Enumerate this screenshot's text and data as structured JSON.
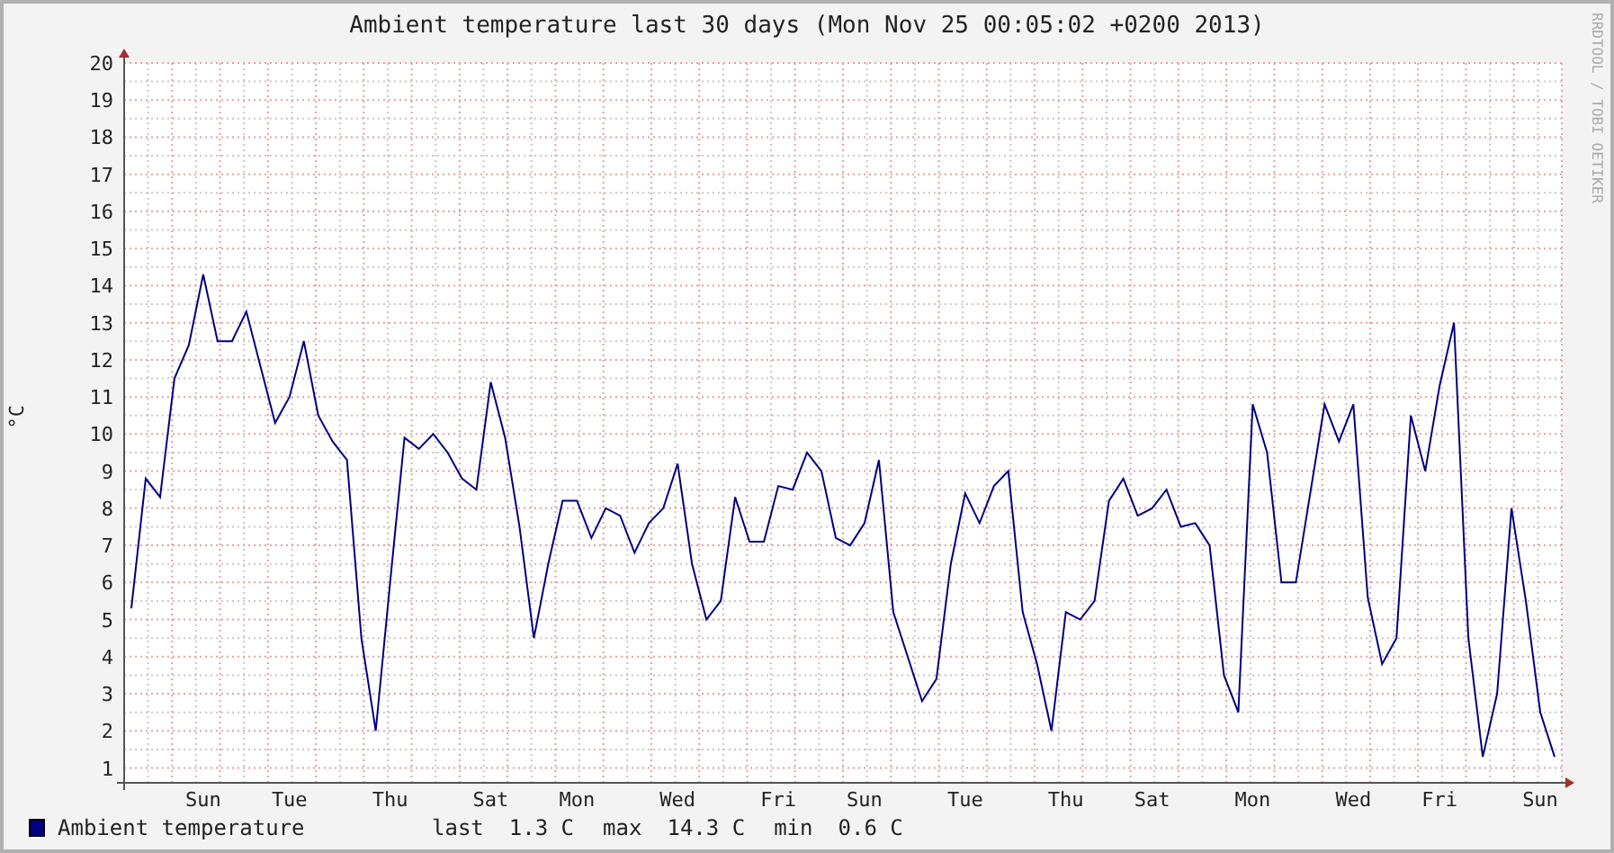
{
  "title": "Ambient temperature last 30 days (Mon Nov 25 00:05:02 +0200 2013)",
  "credit": "RRDTOOL / TOBI OETIKER",
  "chart_data": {
    "type": "line",
    "ylabel": "°C",
    "grid": true,
    "ylim": [
      0.6,
      20
    ],
    "yticks": [
      1,
      2,
      3,
      4,
      5,
      6,
      7,
      8,
      9,
      10,
      11,
      12,
      13,
      14,
      15,
      16,
      17,
      18,
      19,
      20
    ],
    "categories": [
      null,
      null,
      null,
      null,
      null,
      "Sun",
      null,
      null,
      null,
      null,
      null,
      "Tue",
      null,
      null,
      null,
      null,
      null,
      null,
      "Thu",
      null,
      null,
      null,
      null,
      null,
      null,
      "Sat",
      null,
      null,
      null,
      null,
      null,
      "Mon",
      null,
      null,
      null,
      null,
      null,
      null,
      "Wed",
      null,
      null,
      null,
      null,
      null,
      null,
      "Fri",
      null,
      null,
      null,
      null,
      null,
      "Sun",
      null,
      null,
      null,
      null,
      null,
      null,
      "Tue",
      null,
      null,
      null,
      null,
      null,
      null,
      "Thu",
      null,
      null,
      null,
      null,
      null,
      "Sat",
      null,
      null,
      null,
      null,
      null,
      null,
      "Mon",
      null,
      null,
      null,
      null,
      null,
      null,
      "Wed",
      null,
      null,
      null,
      null,
      null,
      "Fri",
      null,
      null,
      null,
      null,
      null,
      null,
      "Sun",
      null
    ],
    "series": [
      {
        "name": "Ambient temperature",
        "color": "#000080",
        "values": [
          5.3,
          8.8,
          8.3,
          11.5,
          12.4,
          14.3,
          12.5,
          12.5,
          13.3,
          11.8,
          10.3,
          11.0,
          12.5,
          10.5,
          9.8,
          9.3,
          4.5,
          2.0,
          6.0,
          9.9,
          9.6,
          10.0,
          9.5,
          8.8,
          8.5,
          11.4,
          9.9,
          7.5,
          4.5,
          6.5,
          8.2,
          8.2,
          7.2,
          8.0,
          7.8,
          6.8,
          7.6,
          8.0,
          9.2,
          6.5,
          5.0,
          5.5,
          8.3,
          7.1,
          7.1,
          8.6,
          8.5,
          9.5,
          9.0,
          7.2,
          7.0,
          7.6,
          9.3,
          5.2,
          4.0,
          2.8,
          3.4,
          6.5,
          8.4,
          7.6,
          8.6,
          9.0,
          5.2,
          3.8,
          2.0,
          5.2,
          5.0,
          5.5,
          8.2,
          8.8,
          7.8,
          8.0,
          8.5,
          7.5,
          7.6,
          7.0,
          3.5,
          2.5,
          10.8,
          9.5,
          6.0,
          6.0,
          8.4,
          10.8,
          9.8,
          10.8,
          5.6,
          3.8,
          4.5,
          10.5,
          9.0,
          11.3,
          13.0,
          4.5,
          1.3,
          3.0,
          8.0,
          5.5,
          2.5,
          1.3
        ]
      }
    ]
  },
  "legend": {
    "stats": [
      {
        "label": "last",
        "value": "1.3 C"
      },
      {
        "label": "max",
        "value": "14.3 C"
      },
      {
        "label": "min",
        "value": "0.6 C"
      }
    ]
  }
}
